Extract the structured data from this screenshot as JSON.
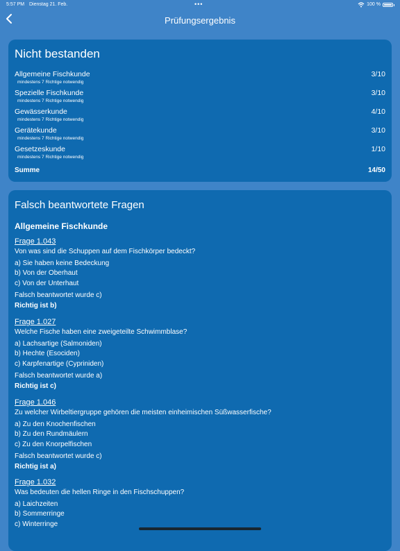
{
  "status": {
    "time": "5:57 PM",
    "date": "Dienstag 21. Feb.",
    "battery": "100 %",
    "battery_level": 1.0
  },
  "nav": {
    "title": "Prüfungsergebnis"
  },
  "result": {
    "title": "Nicht bestanden",
    "rows": [
      {
        "name": "Allgemeine Fischkunde",
        "note": "mindestens 7 Richtige notwendig",
        "score": "3/10"
      },
      {
        "name": "Spezielle Fischkunde",
        "note": "mindestens 7 Richtige notwendig",
        "score": "3/10"
      },
      {
        "name": "Gewässerkunde",
        "note": "mindestens 7 Richtige notwendig",
        "score": "4/10"
      },
      {
        "name": "Gerätekunde",
        "note": "mindestens 7 Richtige notwendig",
        "score": "3/10"
      },
      {
        "name": "Gesetzeskunde",
        "note": "mindestens 7 Richtige notwendig",
        "score": "1/10"
      }
    ],
    "sum_label": "Summe",
    "sum_score": "14/50"
  },
  "wrong": {
    "title": "Falsch beantwortete Fragen",
    "section": "Allgemeine Fischkunde",
    "questions": [
      {
        "number": "Frage 1.043",
        "text": "Von was sind die Schuppen auf dem Fischkörper bedeckt?",
        "answers": [
          "a) Sie haben keine Bedeckung",
          "b) Von der Oberhaut",
          "c) Von der Unterhaut"
        ],
        "wrong": "Falsch beantwortet wurde c)",
        "correct": "Richtig ist b)"
      },
      {
        "number": "Frage 1.027",
        "text": "Welche Fische haben eine zweigeteilte Schwimmblase?",
        "answers": [
          "a) Lachsartige (Salmoniden)",
          "b) Hechte (Esociden)",
          "c) Karpfenartige (Cypriniden)"
        ],
        "wrong": "Falsch beantwortet wurde a)",
        "correct": "Richtig ist c)"
      },
      {
        "number": "Frage 1.046",
        "text": "Zu welcher Wirbeltiergruppe gehören die meisten einheimischen Süßwasserfische?",
        "answers": [
          "a) Zu den Knochenfischen",
          "b) Zu den Rundmäulern",
          "c) Zu den Knorpelfischen"
        ],
        "wrong": "Falsch beantwortet wurde c)",
        "correct": "Richtig ist a)"
      },
      {
        "number": "Frage 1.032",
        "text": "Was bedeuten die hellen Ringe in den Fischschuppen?",
        "answers": [
          "a) Laichzeiten",
          "b) Sommerringe",
          "c) Winterringe"
        ],
        "wrong": "",
        "correct": ""
      }
    ]
  }
}
